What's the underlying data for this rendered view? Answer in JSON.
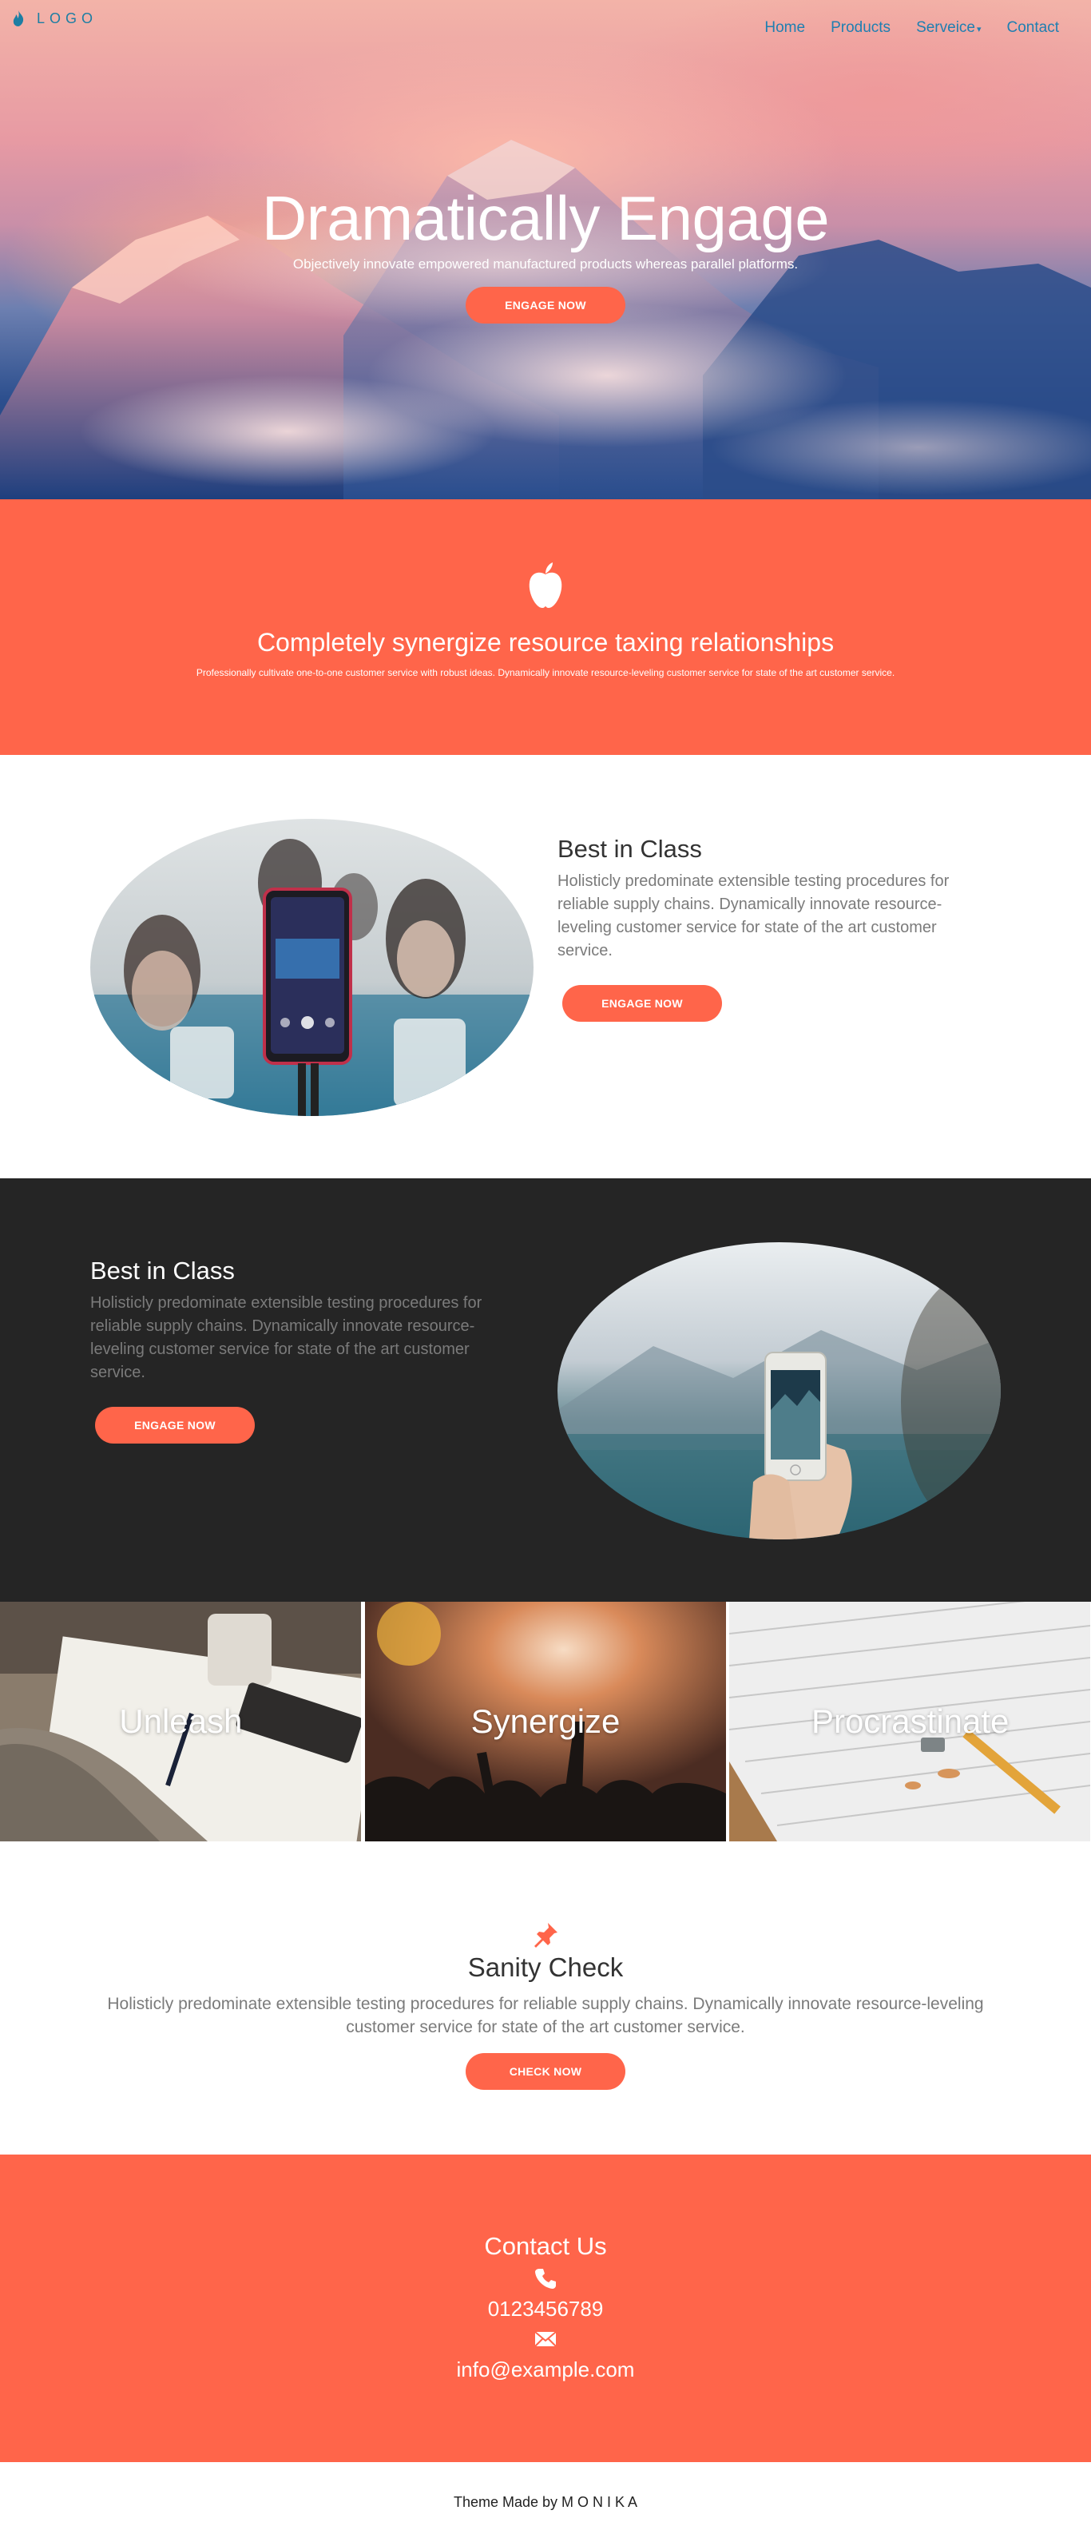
{
  "nav": {
    "logo_text": "LOGO",
    "logo_icon": "flame-icon",
    "links": [
      {
        "label": "Home"
      },
      {
        "label": "Products"
      },
      {
        "label": "Serveice"
      },
      {
        "label": "Contact"
      }
    ],
    "dropdown_caret": "▾"
  },
  "hero": {
    "title": "Dramatically Engage",
    "subtitle": "Objectively innovate empowered manufactured products whereas parallel platforms.",
    "button_label": "ENGAGE NOW"
  },
  "band": {
    "icon": "apple-icon",
    "title": "Completely synergize resource taxing relationships",
    "text": "Professionally cultivate one-to-one customer service with robust ideas. Dynamically innovate resource-leveling customer service for state of the art customer service."
  },
  "features": [
    {
      "title": "Best in Class",
      "text": "Holisticly predominate extensible testing procedures for reliable supply chains. Dynamically innovate resource-leveling customer service for state of the art customer service.",
      "button_label": "ENGAGE NOW"
    },
    {
      "title": "Best in Class",
      "text": "Holisticly predominate extensible testing procedures for reliable supply chains. Dynamically innovate resource-leveling customer service for state of the art customer service.",
      "button_label": "ENGAGE NOW"
    }
  ],
  "tiles": [
    {
      "label": "Unleash"
    },
    {
      "label": "Synergize"
    },
    {
      "label": "Procrastinate"
    }
  ],
  "sanity": {
    "icon": "pushpin-icon",
    "title": "Sanity Check",
    "text": "Holisticly predominate extensible testing procedures for reliable supply chains. Dynamically innovate resource-leveling customer service for state of the art customer service.",
    "button_label": "CHECK NOW"
  },
  "contact": {
    "title": "Contact Us",
    "phone": "0123456789",
    "email": "info@example.com"
  },
  "footer": {
    "text": "Theme Made by M O N I K A"
  },
  "colors": {
    "accent": "#ff654a",
    "dark_section": "#252525",
    "nav_link": "#1f7fb1"
  }
}
